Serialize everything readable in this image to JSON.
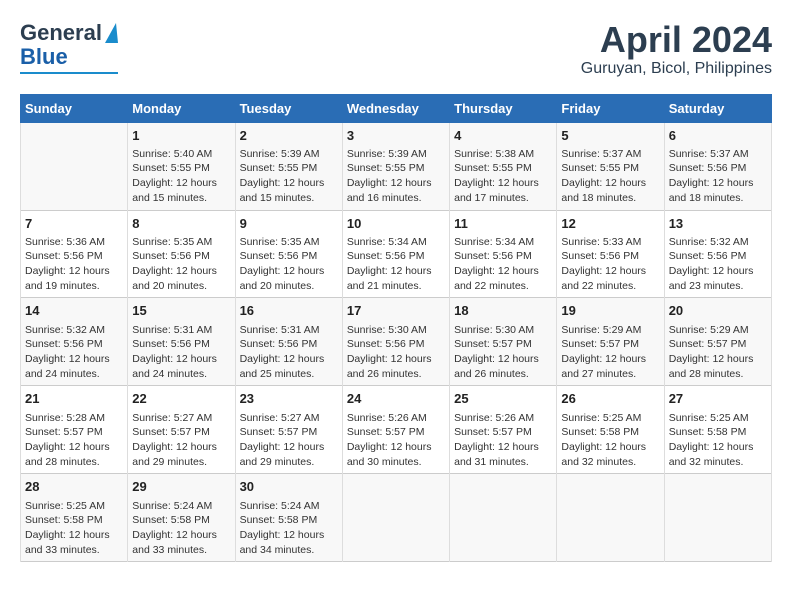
{
  "header": {
    "logo_top": "General",
    "logo_bottom": "Blue",
    "month_title": "April 2024",
    "location": "Guruyan, Bicol, Philippines"
  },
  "columns": [
    "Sunday",
    "Monday",
    "Tuesday",
    "Wednesday",
    "Thursday",
    "Friday",
    "Saturday"
  ],
  "weeks": [
    [
      {
        "day": "",
        "info": ""
      },
      {
        "day": "1",
        "info": "Sunrise: 5:40 AM\nSunset: 5:55 PM\nDaylight: 12 hours\nand 15 minutes."
      },
      {
        "day": "2",
        "info": "Sunrise: 5:39 AM\nSunset: 5:55 PM\nDaylight: 12 hours\nand 15 minutes."
      },
      {
        "day": "3",
        "info": "Sunrise: 5:39 AM\nSunset: 5:55 PM\nDaylight: 12 hours\nand 16 minutes."
      },
      {
        "day": "4",
        "info": "Sunrise: 5:38 AM\nSunset: 5:55 PM\nDaylight: 12 hours\nand 17 minutes."
      },
      {
        "day": "5",
        "info": "Sunrise: 5:37 AM\nSunset: 5:55 PM\nDaylight: 12 hours\nand 18 minutes."
      },
      {
        "day": "6",
        "info": "Sunrise: 5:37 AM\nSunset: 5:56 PM\nDaylight: 12 hours\nand 18 minutes."
      }
    ],
    [
      {
        "day": "7",
        "info": "Sunrise: 5:36 AM\nSunset: 5:56 PM\nDaylight: 12 hours\nand 19 minutes."
      },
      {
        "day": "8",
        "info": "Sunrise: 5:35 AM\nSunset: 5:56 PM\nDaylight: 12 hours\nand 20 minutes."
      },
      {
        "day": "9",
        "info": "Sunrise: 5:35 AM\nSunset: 5:56 PM\nDaylight: 12 hours\nand 20 minutes."
      },
      {
        "day": "10",
        "info": "Sunrise: 5:34 AM\nSunset: 5:56 PM\nDaylight: 12 hours\nand 21 minutes."
      },
      {
        "day": "11",
        "info": "Sunrise: 5:34 AM\nSunset: 5:56 PM\nDaylight: 12 hours\nand 22 minutes."
      },
      {
        "day": "12",
        "info": "Sunrise: 5:33 AM\nSunset: 5:56 PM\nDaylight: 12 hours\nand 22 minutes."
      },
      {
        "day": "13",
        "info": "Sunrise: 5:32 AM\nSunset: 5:56 PM\nDaylight: 12 hours\nand 23 minutes."
      }
    ],
    [
      {
        "day": "14",
        "info": "Sunrise: 5:32 AM\nSunset: 5:56 PM\nDaylight: 12 hours\nand 24 minutes."
      },
      {
        "day": "15",
        "info": "Sunrise: 5:31 AM\nSunset: 5:56 PM\nDaylight: 12 hours\nand 24 minutes."
      },
      {
        "day": "16",
        "info": "Sunrise: 5:31 AM\nSunset: 5:56 PM\nDaylight: 12 hours\nand 25 minutes."
      },
      {
        "day": "17",
        "info": "Sunrise: 5:30 AM\nSunset: 5:56 PM\nDaylight: 12 hours\nand 26 minutes."
      },
      {
        "day": "18",
        "info": "Sunrise: 5:30 AM\nSunset: 5:57 PM\nDaylight: 12 hours\nand 26 minutes."
      },
      {
        "day": "19",
        "info": "Sunrise: 5:29 AM\nSunset: 5:57 PM\nDaylight: 12 hours\nand 27 minutes."
      },
      {
        "day": "20",
        "info": "Sunrise: 5:29 AM\nSunset: 5:57 PM\nDaylight: 12 hours\nand 28 minutes."
      }
    ],
    [
      {
        "day": "21",
        "info": "Sunrise: 5:28 AM\nSunset: 5:57 PM\nDaylight: 12 hours\nand 28 minutes."
      },
      {
        "day": "22",
        "info": "Sunrise: 5:27 AM\nSunset: 5:57 PM\nDaylight: 12 hours\nand 29 minutes."
      },
      {
        "day": "23",
        "info": "Sunrise: 5:27 AM\nSunset: 5:57 PM\nDaylight: 12 hours\nand 29 minutes."
      },
      {
        "day": "24",
        "info": "Sunrise: 5:26 AM\nSunset: 5:57 PM\nDaylight: 12 hours\nand 30 minutes."
      },
      {
        "day": "25",
        "info": "Sunrise: 5:26 AM\nSunset: 5:57 PM\nDaylight: 12 hours\nand 31 minutes."
      },
      {
        "day": "26",
        "info": "Sunrise: 5:25 AM\nSunset: 5:58 PM\nDaylight: 12 hours\nand 32 minutes."
      },
      {
        "day": "27",
        "info": "Sunrise: 5:25 AM\nSunset: 5:58 PM\nDaylight: 12 hours\nand 32 minutes."
      }
    ],
    [
      {
        "day": "28",
        "info": "Sunrise: 5:25 AM\nSunset: 5:58 PM\nDaylight: 12 hours\nand 33 minutes."
      },
      {
        "day": "29",
        "info": "Sunrise: 5:24 AM\nSunset: 5:58 PM\nDaylight: 12 hours\nand 33 minutes."
      },
      {
        "day": "30",
        "info": "Sunrise: 5:24 AM\nSunset: 5:58 PM\nDaylight: 12 hours\nand 34 minutes."
      },
      {
        "day": "",
        "info": ""
      },
      {
        "day": "",
        "info": ""
      },
      {
        "day": "",
        "info": ""
      },
      {
        "day": "",
        "info": ""
      }
    ]
  ]
}
